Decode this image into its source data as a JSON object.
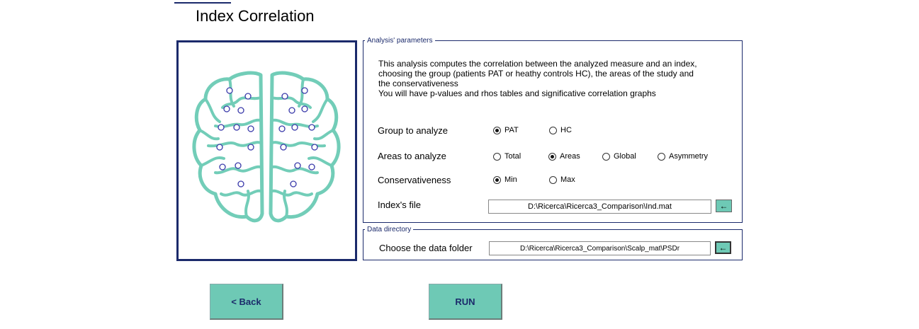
{
  "title": "Index Correlation",
  "colors": {
    "accent": "#6ec9b5",
    "frame": "#1b2a6b"
  },
  "illustration": {
    "icon": "brain-electrodes-icon"
  },
  "params": {
    "legend": "Analysis' parameters",
    "description": [
      "This analysis computes the correlation between the analyzed measure and an index,",
      "choosing the group (patients PAT or heathy controls HC), the areas of the study and",
      "the conservativeness",
      "You will have p-values and rhos tables and significative correlation graphs"
    ],
    "group": {
      "label": "Group to analyze",
      "options": [
        "PAT",
        "HC"
      ],
      "selected": "PAT"
    },
    "areas": {
      "label": "Areas to analyze",
      "options": [
        "Total",
        "Areas",
        "Global",
        "Asymmetry"
      ],
      "selected": "Areas"
    },
    "conservativeness": {
      "label": "Conservativeness",
      "options": [
        "Min",
        "Max"
      ],
      "selected": "Min"
    },
    "index_file": {
      "label": "Index's file",
      "value": "D:\\Ricerca\\Ricerca3_Comparison\\Ind.mat",
      "button_icon": "←"
    }
  },
  "data_dir": {
    "legend": "Data directory",
    "label": "Choose the data folder",
    "value": "D:\\Ricerca\\Ricerca3_Comparison\\Scalp_mat\\PSDr",
    "button_icon": "←"
  },
  "buttons": {
    "back": "<  Back",
    "run": "RUN"
  }
}
